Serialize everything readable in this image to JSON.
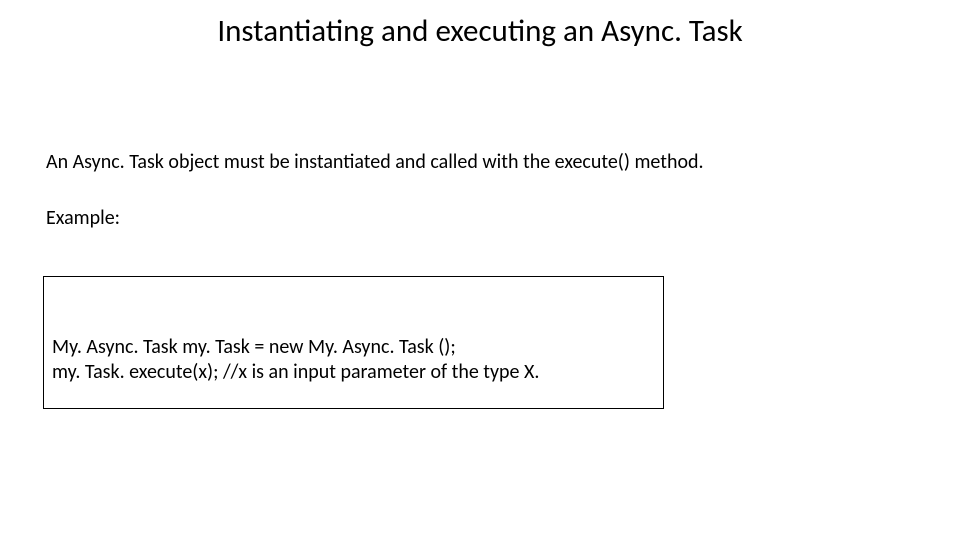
{
  "slide": {
    "title": "Instantiating and executing an Async. Task",
    "intro": "An Async. Task  object must be instantiated and called with the execute() method.",
    "example_label": "Example:",
    "code_line_1": "My. Async. Task my. Task = new My. Async. Task ();",
    "code_line_2": "my. Task. execute(x);    //x is an input parameter of the type X."
  }
}
